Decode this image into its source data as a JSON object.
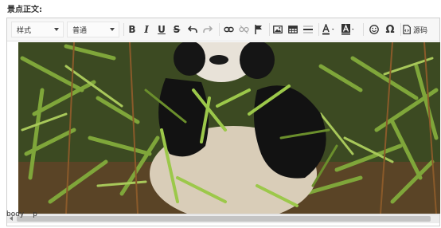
{
  "field_label": "景点正文:",
  "toolbar": {
    "style_select": "样式",
    "format_select": "普通",
    "source_label": "源码",
    "icons": [
      "bold-icon",
      "italic-icon",
      "underline-icon",
      "strikethrough-icon",
      "undo-icon",
      "redo-icon",
      "link-icon",
      "unlink-icon",
      "anchor-flag-icon",
      "image-icon",
      "table-icon",
      "horizontal-rule-icon",
      "text-color-icon",
      "background-color-icon",
      "emoji-icon",
      "special-char-omega-icon",
      "source-code-icon"
    ]
  },
  "content": {
    "image_subject": "giant panda eating bamboo"
  },
  "status_path": [
    "body",
    "p"
  ],
  "colors": {
    "toolbar_bg": "#f7f7f7",
    "border": "#cfcfcf",
    "scroll_thumb": "#c4c4c4"
  }
}
